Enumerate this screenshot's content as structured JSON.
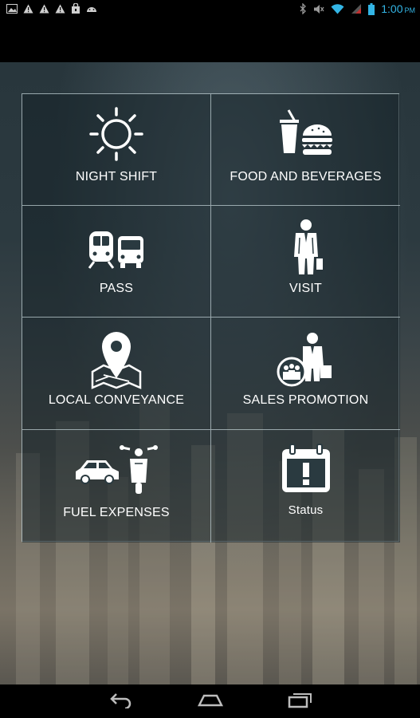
{
  "status_bar": {
    "time": "1:00",
    "time_suffix": "PM",
    "left_icons": [
      "picture-icon",
      "warning-icon",
      "warning-icon",
      "warning-icon",
      "lock-bag-icon",
      "android-icon"
    ],
    "right_icons": [
      "bluetooth-icon",
      "mute-icon",
      "wifi-icon",
      "signal-icon",
      "battery-icon"
    ],
    "accent_color": "#33b5e5"
  },
  "menu": {
    "tiles": [
      {
        "label": "NIGHT SHIFT",
        "icon": "night-sun-moon-icon"
      },
      {
        "label": "FOOD AND BEVERAGES",
        "icon": "food-drink-icon"
      },
      {
        "label": "PASS",
        "icon": "train-bus-icon"
      },
      {
        "label": "VISIT",
        "icon": "businessman-icon"
      },
      {
        "label": "LOCAL CONVEYANCE",
        "icon": "map-pin-icon"
      },
      {
        "label": "SALES PROMOTION",
        "icon": "sales-presenter-icon"
      },
      {
        "label": "FUEL EXPENSES",
        "icon": "car-scooter-icon"
      },
      {
        "label": "Status",
        "icon": "calendar-alert-icon"
      }
    ]
  },
  "nav_bar": {
    "buttons": [
      "back-icon",
      "home-icon",
      "recents-icon"
    ]
  }
}
